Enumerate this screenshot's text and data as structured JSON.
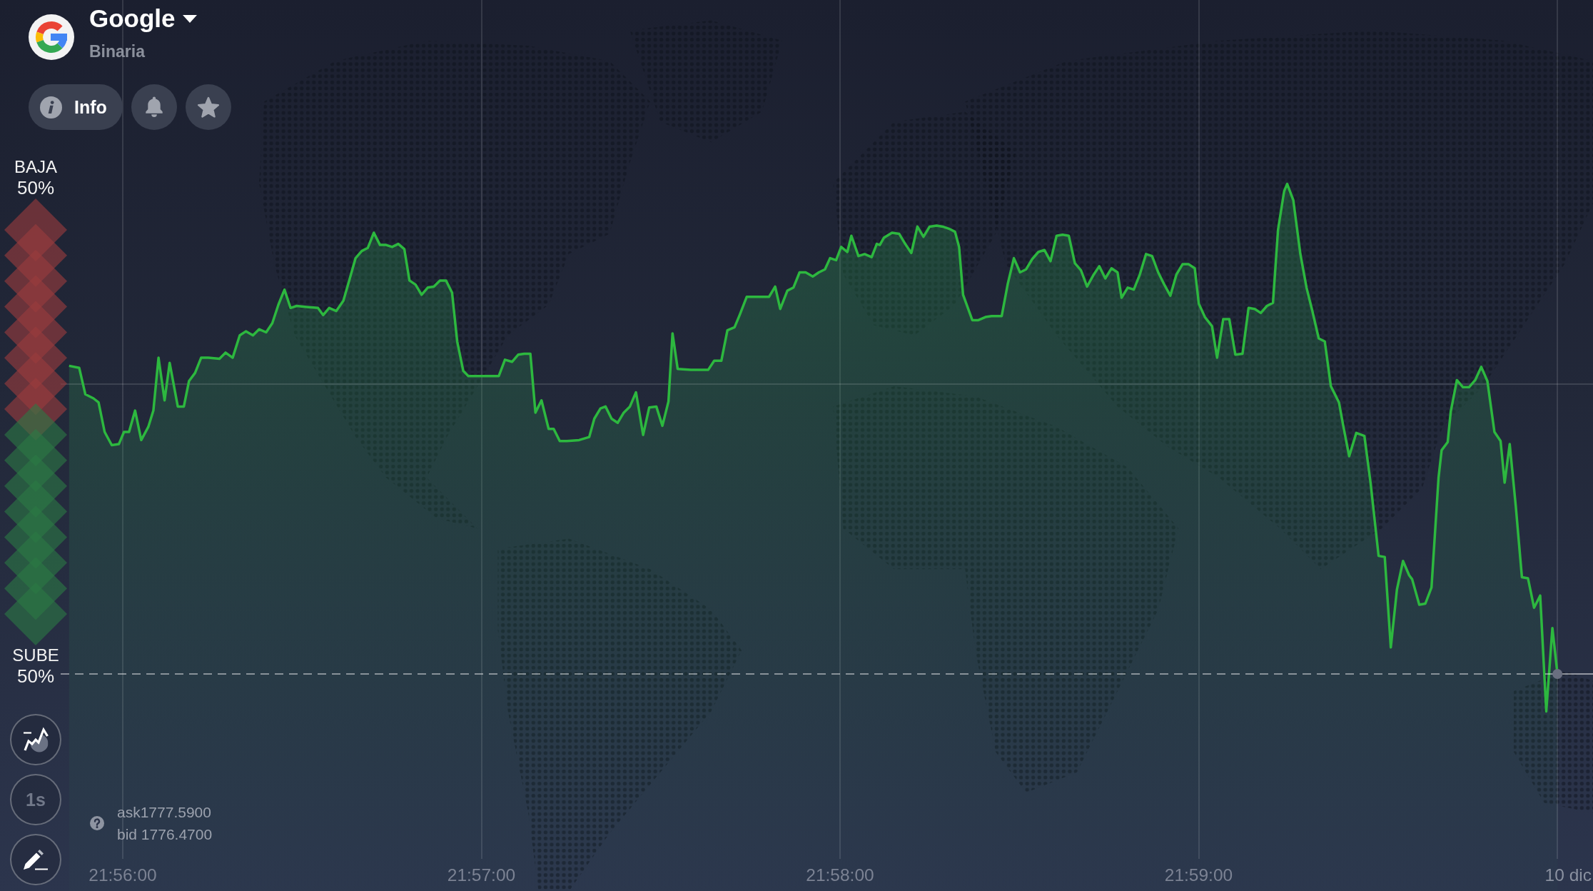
{
  "asset": {
    "name": "Google",
    "type": "Binaria"
  },
  "asset_actions": [
    {
      "kind": "info",
      "label": "Info"
    },
    {
      "kind": "alerts"
    },
    {
      "kind": "favorite"
    }
  ],
  "sentiment": {
    "down_label": "BAJA",
    "down_reading": "50%",
    "up_label": "SUBE",
    "up_reading": "50%",
    "level": 0.5
  },
  "tools": [
    {
      "kind": "chart_type"
    },
    {
      "kind": "timeframe",
      "label": "1s"
    },
    {
      "kind": "drawing"
    }
  ],
  "quote": {
    "ask": "ask1777.5900",
    "bid": "bid 1776.4700"
  },
  "time_axis": {
    "labels": [
      "21:56:00",
      "21:57:00",
      "21:58:00",
      "21:59:00"
    ],
    "date": "10 dic"
  }
}
